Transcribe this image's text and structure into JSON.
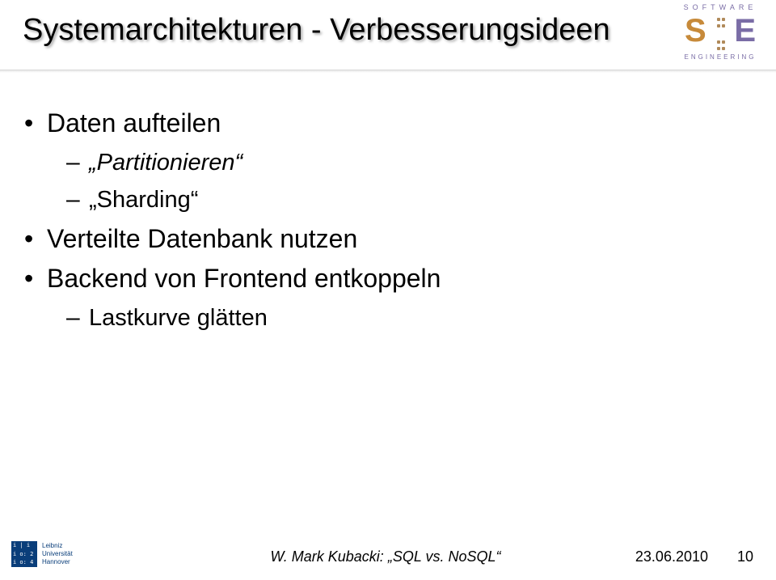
{
  "title": "Systemarchitekturen - Verbesserungsideen",
  "logo": {
    "top_word": "SOFTWARE",
    "letters": {
      "s": "S",
      "e": "E"
    },
    "bottom_word": "ENGINEERING"
  },
  "bullets": {
    "b1": {
      "text": "Daten aufteilen",
      "sub": {
        "s1": "Partitionieren",
        "s2": "Sharding"
      }
    },
    "b2": {
      "text": "Verteilte Datenbank nutzen"
    },
    "b3": {
      "text": "Backend von Frontend entkoppeln",
      "sub": {
        "s1": "Lastkurve glätten"
      }
    }
  },
  "footer": {
    "uni": {
      "line1": "Leibniz",
      "line2": "Universität",
      "line3": "Hannover",
      "mark": {
        "r1": "i | i",
        "r2": "i o: 2",
        "r3": "i o: 4"
      }
    },
    "center_author": "W. Mark Kubacki: ",
    "center_title": "SQL vs. NoSQL",
    "date": "23.06.2010",
    "page": "10"
  }
}
